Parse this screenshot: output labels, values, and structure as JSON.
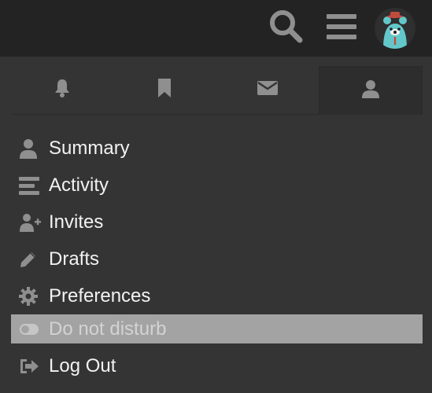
{
  "header": {
    "search_icon": "search-icon",
    "menu_icon": "hamburger-icon",
    "avatar_icon": "bear-avatar"
  },
  "tabs": [
    {
      "icon": "bell-icon",
      "active": false
    },
    {
      "icon": "bookmark-icon",
      "active": false
    },
    {
      "icon": "envelope-icon",
      "active": false
    },
    {
      "icon": "user-icon",
      "active": true
    }
  ],
  "menu": {
    "items": [
      {
        "label": "Summary",
        "icon": "user-icon"
      },
      {
        "label": "Activity",
        "icon": "stream-icon"
      },
      {
        "label": "Invites",
        "icon": "user-plus-icon"
      },
      {
        "label": "Drafts",
        "icon": "pencil-icon"
      },
      {
        "label": "Preferences",
        "icon": "gear-icon"
      },
      {
        "label": "Do not disturb",
        "icon": "toggle-off-icon",
        "highlighted": true
      },
      {
        "label": "Log Out",
        "icon": "sign-out-icon"
      }
    ]
  },
  "colors": {
    "header_bg": "#232323",
    "panel_bg": "#343434",
    "text": "#f2f2f2",
    "icon_gray": "#8f8f8f",
    "highlight_bg": "#a3a3a3",
    "avatar_teal": "#63c7ca"
  }
}
